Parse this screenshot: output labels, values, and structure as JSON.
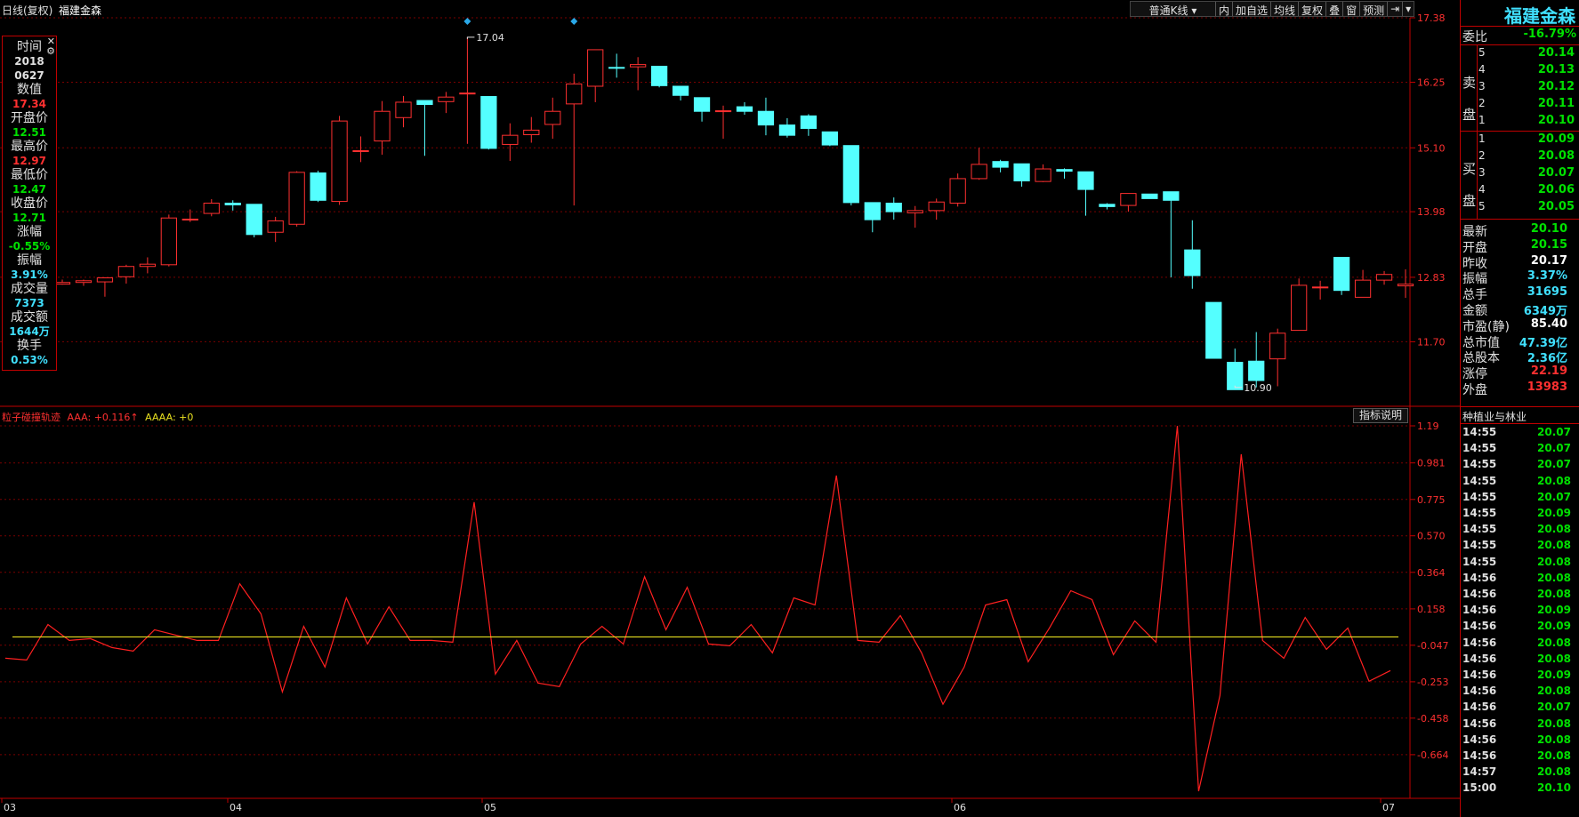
{
  "header": {
    "mode": "日线(复权)",
    "stock": "福建金森"
  },
  "toolbar": {
    "ktype": "普通K线",
    "btns": [
      "内",
      "加自选",
      "均线",
      "复权",
      "叠",
      "窗",
      "预测"
    ]
  },
  "info_panel": {
    "items": [
      {
        "label": "时间",
        "value": "2018",
        "value2": "0627",
        "color": "#e0e0e0"
      },
      {
        "label": "数值",
        "value": "17.34",
        "color": "#ff3030"
      },
      {
        "label": "开盘价",
        "value": "12.51",
        "color": "#00e000"
      },
      {
        "label": "最高价",
        "value": "12.97",
        "color": "#ff3030"
      },
      {
        "label": "最低价",
        "value": "12.47",
        "color": "#00e000"
      },
      {
        "label": "收盘价",
        "value": "12.71",
        "color": "#00e000"
      },
      {
        "label": "涨幅",
        "value": "-0.55%",
        "color": "#00e000"
      },
      {
        "label": "振幅",
        "value": "3.91%",
        "color": "#40e0ff"
      },
      {
        "label": "成交量",
        "value": "7373",
        "color": "#40e0ff"
      },
      {
        "label": "成交额",
        "value": "1644万",
        "color": "#40e0ff"
      },
      {
        "label": "换手",
        "value": "0.53%",
        "color": "#40e0ff"
      }
    ]
  },
  "main_axis": {
    "labels": [
      "17.38",
      "16.25",
      "15.10",
      "13.98",
      "12.83",
      "11.70"
    ],
    "high_label": "17.04",
    "low_label": "10.90"
  },
  "indicator": {
    "name": "粒子碰撞轨迹",
    "aaa_label": "AAA: +0.116",
    "aaaa_label": "AAAA: +0",
    "help": "指标说明",
    "axis": [
      "1.19",
      "0.981",
      "0.775",
      "0.570",
      "0.364",
      "0.158",
      "-0.047",
      "-0.253",
      "-0.458",
      "-0.664"
    ]
  },
  "x_axis": {
    "labels": [
      "03",
      "04",
      "05",
      "06",
      "07"
    ]
  },
  "right_panel": {
    "title": "福建金森",
    "weibi": {
      "label": "委比",
      "value": "-16.79%"
    },
    "sell_label": [
      "卖",
      "盘"
    ],
    "sell": [
      {
        "n": "5",
        "p": "20.14"
      },
      {
        "n": "4",
        "p": "20.13"
      },
      {
        "n": "3",
        "p": "20.12"
      },
      {
        "n": "2",
        "p": "20.11"
      },
      {
        "n": "1",
        "p": "20.10"
      }
    ],
    "buy_label": [
      "买",
      "盘"
    ],
    "buy": [
      {
        "n": "1",
        "p": "20.09"
      },
      {
        "n": "2",
        "p": "20.08"
      },
      {
        "n": "3",
        "p": "20.07"
      },
      {
        "n": "4",
        "p": "20.06"
      },
      {
        "n": "5",
        "p": "20.05"
      }
    ],
    "stats": [
      {
        "k": "最新",
        "v": "20.10",
        "c": "#00e000"
      },
      {
        "k": "开盘",
        "v": "20.15",
        "c": "#00e000"
      },
      {
        "k": "昨收",
        "v": "20.17",
        "c": "#ffffff"
      },
      {
        "k": "振幅",
        "v": "3.37%",
        "c": "#40e0ff"
      },
      {
        "k": "总手",
        "v": "31695",
        "c": "#40e0ff"
      },
      {
        "k": "金额",
        "v": "6349万",
        "c": "#40e0ff"
      },
      {
        "k": "市盈(静)",
        "v": "85.40",
        "c": "#ffffff"
      },
      {
        "k": "总市值",
        "v": "47.39亿",
        "c": "#40e0ff"
      },
      {
        "k": "总股本",
        "v": "2.36亿",
        "c": "#40e0ff"
      },
      {
        "k": "涨停",
        "v": "22.19",
        "c": "#ff3030"
      },
      {
        "k": "外盘",
        "v": "13983",
        "c": "#ff3030"
      }
    ],
    "industry": "种植业与林业",
    "trades": [
      {
        "t": "14:55",
        "p": "20.07"
      },
      {
        "t": "14:55",
        "p": "20.07"
      },
      {
        "t": "14:55",
        "p": "20.07"
      },
      {
        "t": "14:55",
        "p": "20.08"
      },
      {
        "t": "14:55",
        "p": "20.07"
      },
      {
        "t": "14:55",
        "p": "20.09"
      },
      {
        "t": "14:55",
        "p": "20.08"
      },
      {
        "t": "14:55",
        "p": "20.08"
      },
      {
        "t": "14:55",
        "p": "20.08"
      },
      {
        "t": "14:56",
        "p": "20.08"
      },
      {
        "t": "14:56",
        "p": "20.08"
      },
      {
        "t": "14:56",
        "p": "20.09"
      },
      {
        "t": "14:56",
        "p": "20.09"
      },
      {
        "t": "14:56",
        "p": "20.08"
      },
      {
        "t": "14:56",
        "p": "20.08"
      },
      {
        "t": "14:56",
        "p": "20.09"
      },
      {
        "t": "14:56",
        "p": "20.08"
      },
      {
        "t": "14:56",
        "p": "20.07"
      },
      {
        "t": "14:56",
        "p": "20.08"
      },
      {
        "t": "14:56",
        "p": "20.08"
      },
      {
        "t": "14:56",
        "p": "20.08"
      },
      {
        "t": "14:57",
        "p": "20.08"
      },
      {
        "t": "15:00",
        "p": "20.10"
      }
    ]
  },
  "chart_data": [
    {
      "type": "candlestick",
      "title": "日线(复权)",
      "ylim": [
        10.6,
        17.38
      ],
      "candles": [
        [
          12.71,
          12.79,
          12.7,
          12.74
        ],
        [
          12.74,
          12.79,
          12.68,
          12.77
        ],
        [
          12.75,
          12.83,
          12.49,
          12.82
        ],
        [
          12.84,
          13.05,
          12.72,
          13.02
        ],
        [
          13.02,
          13.18,
          12.9,
          13.06
        ],
        [
          13.05,
          13.93,
          13.02,
          13.87
        ],
        [
          13.85,
          14.02,
          13.8,
          13.85
        ],
        [
          13.95,
          14.2,
          13.9,
          14.13
        ],
        [
          14.13,
          14.18,
          14.0,
          14.1
        ],
        [
          14.11,
          14.1,
          13.53,
          13.58
        ],
        [
          13.62,
          13.89,
          13.45,
          13.82
        ],
        [
          13.76,
          14.69,
          13.72,
          14.67
        ],
        [
          14.66,
          14.7,
          14.15,
          14.18
        ],
        [
          14.16,
          15.66,
          14.1,
          15.57
        ],
        [
          15.05,
          15.3,
          14.85,
          15.05
        ],
        [
          15.22,
          15.92,
          14.98,
          15.74
        ],
        [
          15.63,
          16.01,
          15.46,
          15.9
        ],
        [
          15.93,
          15.91,
          14.96,
          15.86
        ],
        [
          15.91,
          16.08,
          15.71,
          15.99
        ],
        [
          16.06,
          17.04,
          15.17,
          16.06
        ],
        [
          16.0,
          15.99,
          15.07,
          15.09
        ],
        [
          15.16,
          15.53,
          14.87,
          15.32
        ],
        [
          15.33,
          15.64,
          15.19,
          15.41
        ],
        [
          15.51,
          15.98,
          15.26,
          15.74
        ],
        [
          15.87,
          16.4,
          14.09,
          16.22
        ],
        [
          16.18,
          16.77,
          15.9,
          16.82
        ],
        [
          16.51,
          16.75,
          16.33,
          16.5
        ],
        [
          16.52,
          16.69,
          16.11,
          16.56
        ],
        [
          16.53,
          16.5,
          16.16,
          16.19
        ],
        [
          16.18,
          16.16,
          15.93,
          16.02
        ],
        [
          15.98,
          15.97,
          15.56,
          15.74
        ],
        [
          15.74,
          15.84,
          15.26,
          15.75
        ],
        [
          15.82,
          15.9,
          15.68,
          15.74
        ],
        [
          15.74,
          15.98,
          15.32,
          15.5
        ],
        [
          15.5,
          15.62,
          15.28,
          15.32
        ],
        [
          15.66,
          15.69,
          15.31,
          15.44
        ],
        [
          15.38,
          15.38,
          15.13,
          15.15
        ],
        [
          15.14,
          15.12,
          14.09,
          14.14
        ],
        [
          14.14,
          14.02,
          13.62,
          13.84
        ],
        [
          14.13,
          14.23,
          13.84,
          13.98
        ],
        [
          13.96,
          14.08,
          13.7,
          14.0
        ],
        [
          14.0,
          14.21,
          13.84,
          14.15
        ],
        [
          14.13,
          14.65,
          14.07,
          14.56
        ],
        [
          14.56,
          15.1,
          14.54,
          14.81
        ],
        [
          14.86,
          14.89,
          14.67,
          14.76
        ],
        [
          14.82,
          14.8,
          14.42,
          14.52
        ],
        [
          14.51,
          14.81,
          14.5,
          14.73
        ],
        [
          14.72,
          14.74,
          14.56,
          14.69
        ],
        [
          14.68,
          14.64,
          13.91,
          14.37
        ],
        [
          14.11,
          14.13,
          14.02,
          14.07
        ],
        [
          14.09,
          14.18,
          13.98,
          14.3
        ],
        [
          14.29,
          14.28,
          14.22,
          14.21
        ],
        [
          14.33,
          14.25,
          12.83,
          14.18
        ],
        [
          13.31,
          13.83,
          12.63,
          12.86
        ],
        [
          12.39,
          12.36,
          11.44,
          11.41
        ],
        [
          11.34,
          11.58,
          10.9,
          10.86
        ],
        [
          11.36,
          11.87,
          10.9,
          11.02
        ],
        [
          11.4,
          11.93,
          10.92,
          11.85
        ],
        [
          11.9,
          12.81,
          11.96,
          12.69
        ],
        [
          12.65,
          12.77,
          12.44,
          12.66
        ],
        [
          13.18,
          13.1,
          12.52,
          12.6
        ],
        [
          12.48,
          12.96,
          12.48,
          12.78
        ],
        [
          12.78,
          12.94,
          12.7,
          12.88
        ],
        [
          12.68,
          12.97,
          12.47,
          12.71
        ]
      ]
    },
    {
      "type": "line",
      "title": "粒子碰撞轨迹",
      "ylim": [
        -0.87,
        1.19
      ],
      "series": [
        {
          "name": "AAA",
          "color": "#ff2020",
          "values": [
            -0.12,
            -0.13,
            0.07,
            -0.02,
            -0.01,
            -0.06,
            -0.08,
            0.04,
            0.01,
            -0.02,
            -0.02,
            0.3,
            0.13,
            -0.31,
            0.06,
            -0.17,
            0.22,
            -0.04,
            0.17,
            -0.02,
            -0.02,
            -0.03,
            0.76,
            -0.21,
            -0.02,
            -0.26,
            -0.28,
            -0.04,
            0.06,
            -0.04,
            0.34,
            0.04,
            0.28,
            -0.04,
            -0.05,
            0.07,
            -0.09,
            0.22,
            0.18,
            0.91,
            -0.02,
            -0.03,
            0.12,
            -0.09,
            -0.38,
            -0.17,
            0.18,
            0.21,
            -0.14,
            0.05,
            0.26,
            0.21,
            -0.1,
            0.09,
            -0.03,
            1.19,
            -0.87,
            -0.33,
            1.03,
            -0.02,
            -0.12,
            0.11,
            -0.07,
            0.05,
            -0.25,
            -0.19
          ]
        },
        {
          "name": "AAAA",
          "color": "#e8e020",
          "values": [
            0,
            0
          ]
        }
      ]
    }
  ]
}
